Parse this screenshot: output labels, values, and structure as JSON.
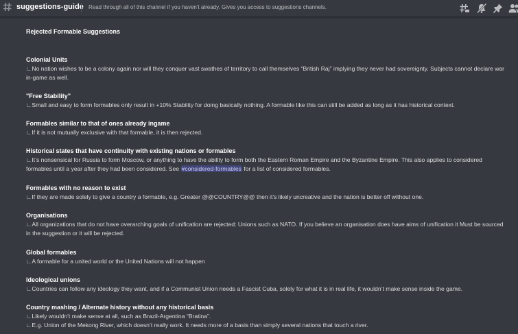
{
  "header": {
    "channel_name": "suggestions-guide",
    "topic": "Read through all of this channel if you haven't already. Gives you access to suggestions channels.",
    "icons": [
      "threads-icon",
      "notifications-muted-icon",
      "pin-icon",
      "members-icon"
    ]
  },
  "message": {
    "title": "Rejected Formable Suggestions",
    "sections": [
      {
        "heading": "Colonial Units",
        "lines": [
          "∟No nation wishes to be a colony again nor will they conquer vast swathes of territory to call themselves “British Raj” implying they never had sovereignty. Subjects cannot declare war in-game as well."
        ]
      },
      {
        "heading": "\"Free Stability\"",
        "lines": [
          "∟Small and easy to form formables only result in +10% Stability for doing basically nothing. A formable like this can still be added as long as it has historical context."
        ]
      },
      {
        "heading": "Formables similar to that of ones already ingame",
        "lines": [
          "∟If it is not mutually exclusive with that formable, it is then rejected."
        ]
      },
      {
        "heading": "Historical states that have continuity with existing nations or formables",
        "line_before_mention": "∟It’s nonsensical for Russia to form Moscow, or anything to have the ability to form both the Eastern Roman Empire and the Byzantine Empire. This also applies to considered formables until a year after they had been considered. See ",
        "mention": "#considered-formables",
        "line_after_mention": " for a list of considered formables."
      },
      {
        "heading": "Formables with no reason to exist",
        "lines": [
          "∟If they are made solely to give a country a formable, e.g. Greater @@COUNTRY@@ then it’s likely uncreative and the nation is better off without one."
        ]
      },
      {
        "heading": "Organisations",
        "lines": [
          "∟All organizations that do not have overarching goals of unification are rejected: Unions such as NATO. If you believe an organisation does have aims of unification it Must be sourced in the suggestion or it will be rejected."
        ]
      },
      {
        "heading": "Global formables",
        "lines": [
          "∟A formable for a united world or the United Nations will not happen"
        ]
      },
      {
        "heading": "Ideological unions",
        "lines": [
          "∟Countries can follow any ideology they want, and if a Communist Union needs a Fascist Cuba, solely for what it is in real life, it wouldn’t make sense inside the game."
        ]
      },
      {
        "heading": "Country mashing / Alternate history without any historical basis",
        "lines": [
          "∟Likely wouldn’t make sense at all, such as Brazil-Argentina “Bratina”.",
          "∟E.g. Union of the Mekong River, which doesn’t really work. It needs more of a basis than simply several nations that touch a river."
        ]
      }
    ]
  },
  "colors": {
    "background": "#36393f",
    "text": "#dcddde",
    "heading": "#ffffff",
    "mention_bg": "#414675",
    "mention_text": "#c9cdfb"
  }
}
